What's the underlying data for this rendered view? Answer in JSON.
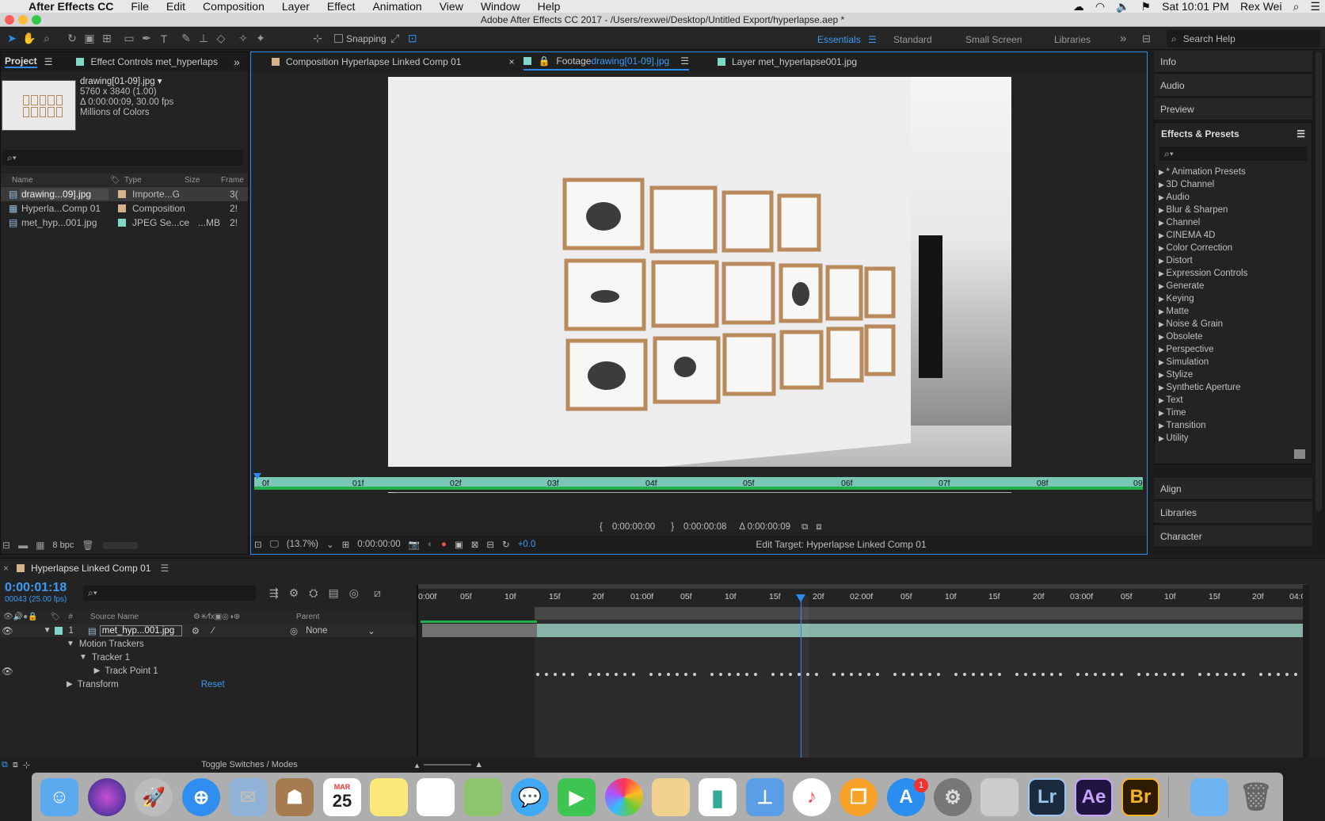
{
  "menubar": {
    "app": "After Effects CC",
    "items": [
      "File",
      "Edit",
      "Composition",
      "Layer",
      "Effect",
      "Animation",
      "View",
      "Window",
      "Help"
    ],
    "clock": "Sat 10:01 PM",
    "user": "Rex Wei"
  },
  "window_title": "Adobe After Effects CC 2017 - /Users/rexwei/Desktop/Untitled Export/hyperlapse.aep *",
  "toolbar": {
    "snapping": "Snapping",
    "workspaces": [
      "Essentials",
      "Standard",
      "Small Screen",
      "Libraries"
    ],
    "search_placeholder": "Search Help"
  },
  "project": {
    "tab": "Project",
    "tab2": "Effect Controls met_hyperlaps",
    "preview_name": "drawing[01-09].jpg ▾",
    "preview_dims": "5760 x 3840 (1.00)",
    "preview_duration": "Δ 0:00:00:09, 30.00 fps",
    "preview_colors": "Millions of Colors",
    "cols": {
      "name": "Name",
      "type": "Type",
      "size": "Size",
      "frame": "Frame"
    },
    "items": [
      {
        "name": "drawing...09].jpg",
        "type": "Importe...G",
        "size": "",
        "frame": "3("
      },
      {
        "name": "Hyperla...Comp 01",
        "type": "Composition",
        "size": "",
        "frame": "2!"
      },
      {
        "name": "met_hyp...001.jpg",
        "type": "JPEG Se...ce",
        "size": "...MB",
        "frame": "2!"
      }
    ],
    "bpc": "8 bpc"
  },
  "viewer": {
    "tabs": [
      {
        "label": "Composition Hyperlapse Linked Comp 01"
      },
      {
        "label": "Footage ",
        "label_highlight": "drawing[01-09].jpg"
      },
      {
        "label": "Layer met_hyperlapse001.jpg"
      }
    ],
    "ruler_ticks": [
      "0f",
      "01f",
      "02f",
      "03f",
      "04f",
      "05f",
      "06f",
      "07f",
      "08f",
      "09"
    ],
    "in_point": "0:00:00:00",
    "out_point": "0:00:00:08",
    "duration": "Δ 0:00:00:09",
    "zoom": "(13.7%)",
    "timecode": "0:00:00:00",
    "exposure": "+0.0",
    "edit_target": "Edit Target: Hyperlapse Linked Comp 01"
  },
  "right_panel": {
    "top_items": [
      "Info",
      "Audio",
      "Preview"
    ],
    "effects_title": "Effects & Presets",
    "effects": [
      "* Animation Presets",
      "3D Channel",
      "Audio",
      "Blur & Sharpen",
      "Channel",
      "CINEMA 4D",
      "Color Correction",
      "Distort",
      "Expression Controls",
      "Generate",
      "Keying",
      "Matte",
      "Noise & Grain",
      "Obsolete",
      "Perspective",
      "Simulation",
      "Stylize",
      "Synthetic Aperture",
      "Text",
      "Time",
      "Transition",
      "Utility"
    ],
    "bottom_items": [
      "Align",
      "Libraries",
      "Character"
    ]
  },
  "timeline": {
    "comp_tab": "Hyperlapse Linked Comp 01",
    "timecode": "0:00:01:18",
    "frame_info": "00043 (25.00 fps)",
    "ruler_ticks": [
      "0:00f",
      "05f",
      "10f",
      "15f",
      "20f",
      "01:00f",
      "05f",
      "10f",
      "15f",
      "20f",
      "02:00f",
      "05f",
      "10f",
      "15f",
      "20f",
      "03:00f",
      "05f",
      "10f",
      "15f",
      "20f",
      "04:0"
    ],
    "columns": {
      "source_name": "Source Name",
      "parent": "Parent",
      "num": "#"
    },
    "layer": {
      "num": "1",
      "name": "met_hyp...001.jpg",
      "parent": "None"
    },
    "rows": [
      "Motion Trackers",
      "Tracker 1",
      "Track Point 1",
      "Transform"
    ],
    "reset": "Reset",
    "toggle": "Toggle Switches / Modes"
  },
  "dock": {
    "calendar_month": "MAR",
    "calendar_day": "25",
    "appstore_badge": "1",
    "apps": [
      "Lr",
      "Ae",
      "Br"
    ]
  }
}
